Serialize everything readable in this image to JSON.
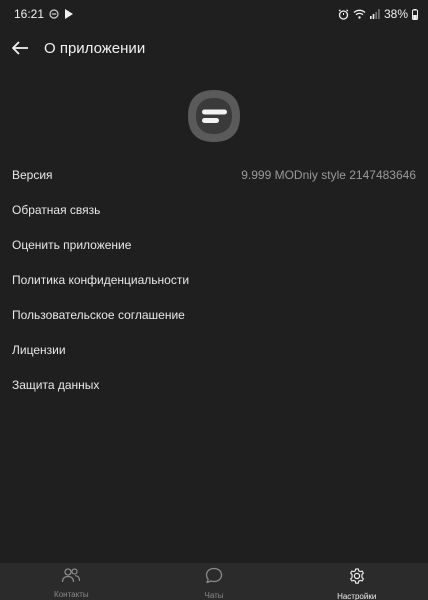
{
  "status_bar": {
    "time": "16:21",
    "battery": "38%"
  },
  "header": {
    "title": "О приложении"
  },
  "settings": {
    "items": [
      {
        "label": "Версия",
        "value": "9.999 MODniy style 2147483646"
      },
      {
        "label": "Обратная связь"
      },
      {
        "label": "Оценить приложение"
      },
      {
        "label": "Политика конфиденциальности"
      },
      {
        "label": "Пользовательское соглашение"
      },
      {
        "label": "Лицензии"
      },
      {
        "label": "Защита данных"
      }
    ]
  },
  "bottom_nav": {
    "items": [
      {
        "label": "Контакты",
        "icon": "contacts-icon",
        "active": false
      },
      {
        "label": "Чаты",
        "icon": "chat-bubble-icon",
        "active": false
      },
      {
        "label": "Настройки",
        "icon": "gear-icon",
        "active": true
      }
    ]
  },
  "colors": {
    "background": "#1f1f1f",
    "nav_background": "#2b2b2b",
    "logo_outer": "#5a5a5a",
    "logo_inner": "#3a3a3a"
  }
}
